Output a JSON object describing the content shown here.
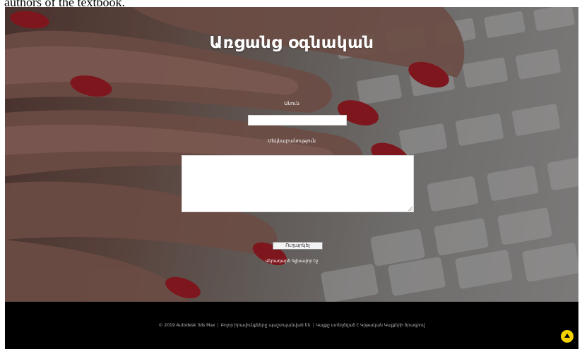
{
  "page": {
    "caption": "authors of the textbook."
  },
  "form": {
    "title": "Առցանց օգնական",
    "name_label": "Անուն",
    "name_value": "",
    "email_label": "Մեկնաբանություն",
    "message_value": "",
    "send_label": "Ուղարկել",
    "back_link": "Վերադարձ Գլխավոր էջ"
  },
  "footer": {
    "copyright": "© 2019 Autodesk 3ds Max",
    "link_1": "Բոլոր իրավունքները պաշտպանված են",
    "link_2": "Կայքը ստեղծված է Կրթական Կայքերի ծրագրով",
    "separator": "|",
    "scroll_top_icon": "arrow-up-icon"
  },
  "colors": {
    "footer_bg": "#000000",
    "scroll_top": "#f3d200",
    "title_text": "#ffffff"
  }
}
